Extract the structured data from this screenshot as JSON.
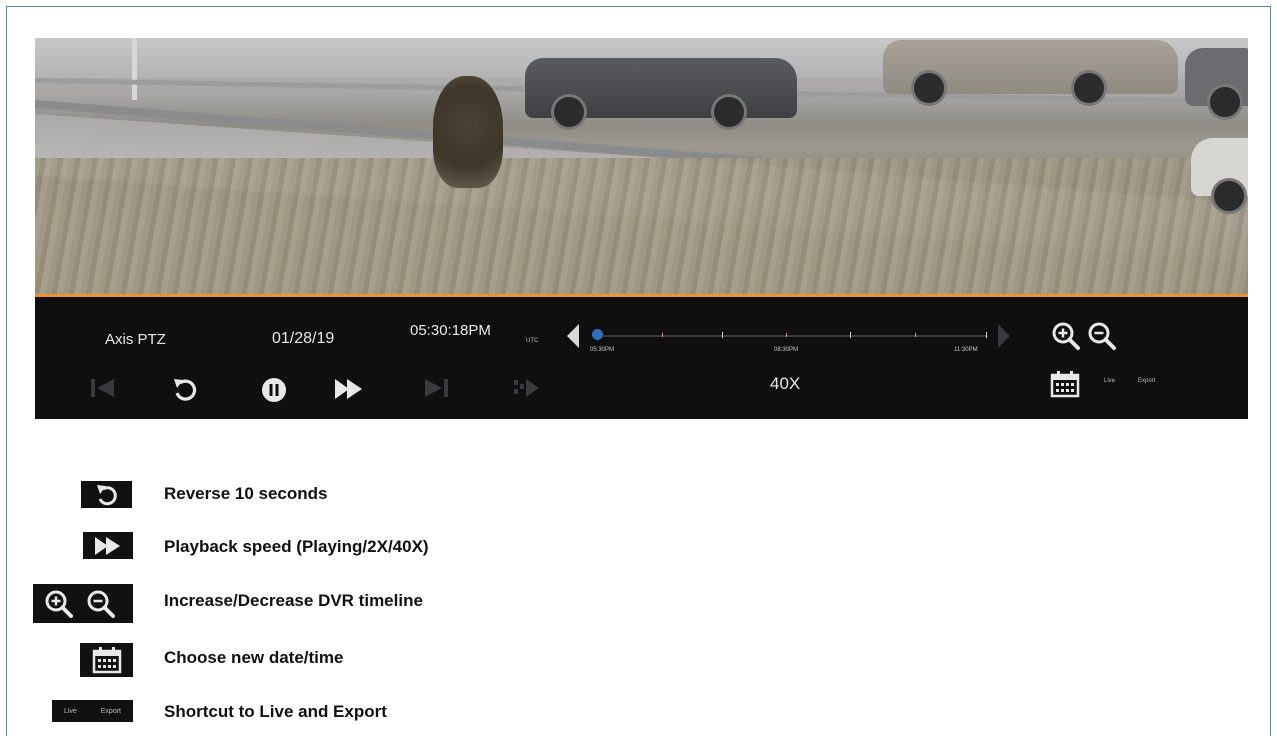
{
  "player": {
    "camera_name": "Axis PTZ",
    "date": "01/28/19",
    "time": "05:30:18PM",
    "timezone": "UTC",
    "speed": "40X",
    "timeline": {
      "labels": [
        "05:30PM",
        "08:30PM",
        "11:30PM"
      ]
    },
    "live_label": "Live",
    "export_label": "Export",
    "accent_color": "#f0932b",
    "cursor_color": "#2e6fb8"
  },
  "legend": [
    {
      "icon": "reverse-10s-icon",
      "text": "Reverse 10 seconds"
    },
    {
      "icon": "fast-forward-icon",
      "text": "Playback speed (Playing/2X/40X)"
    },
    {
      "icon": "zoom-in-out-icon",
      "text": "Increase/Decrease DVR timeline"
    },
    {
      "icon": "calendar-icon",
      "text": "Choose new date/time"
    },
    {
      "icon": "live-export-icon",
      "text": "Shortcut to Live and Export",
      "live": "Live",
      "export": "Export"
    }
  ]
}
